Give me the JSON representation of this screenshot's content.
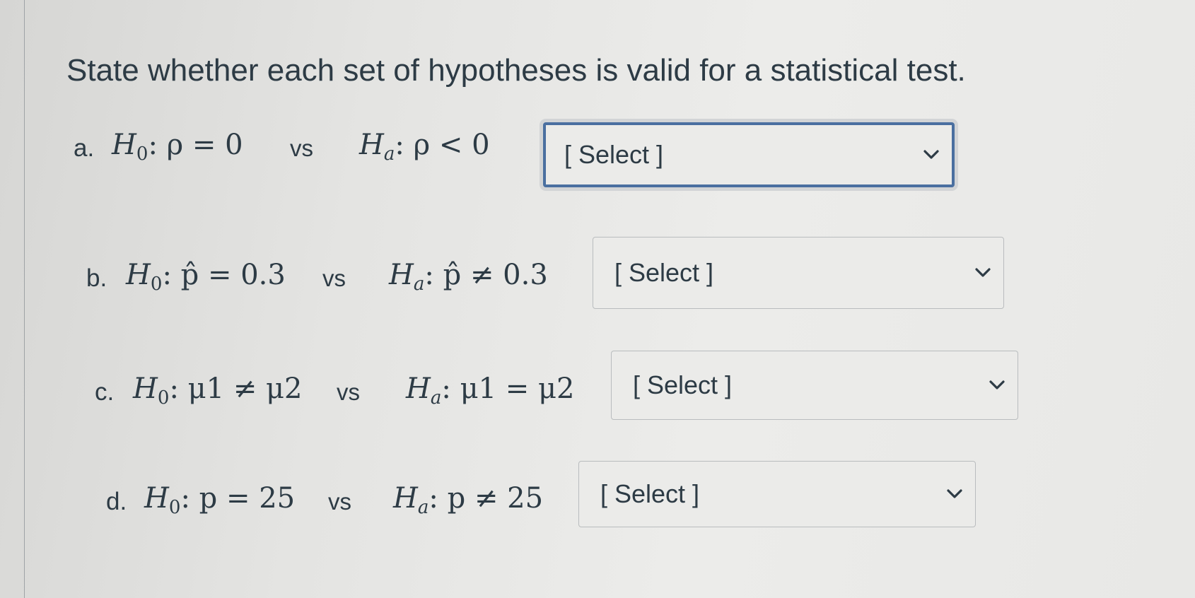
{
  "question": {
    "text": "State whether each set of hypotheses is valid for a statistical test."
  },
  "items": [
    {
      "letter": "a.",
      "null_hypothesis": "ρ = 0",
      "vs": "vs",
      "alternative_hypothesis": "ρ < 0",
      "select_value": "[ Select ]",
      "icon": "chevron-down-icon"
    },
    {
      "letter": "b.",
      "null_hypothesis": "p̂ = 0.3",
      "vs": "vs",
      "alternative_hypothesis": "p̂ ≠ 0.3",
      "select_value": "[ Select ]",
      "icon": "chevron-down-icon"
    },
    {
      "letter": "c.",
      "null_hypothesis": "μ1 ≠ μ2",
      "vs": "vs",
      "alternative_hypothesis": "μ1 = μ2",
      "select_value": "[ Select ]",
      "icon": "chevron-down-icon"
    },
    {
      "letter": "d.",
      "null_hypothesis": "p = 25",
      "vs": "vs",
      "alternative_hypothesis": "p ≠ 25",
      "select_value": "[ Select ]",
      "icon": "chevron-down-icon"
    }
  ],
  "colors": {
    "text": "#2d3b45",
    "focus_border": "#4a6fa0",
    "select_border": "#b9bcbe"
  }
}
